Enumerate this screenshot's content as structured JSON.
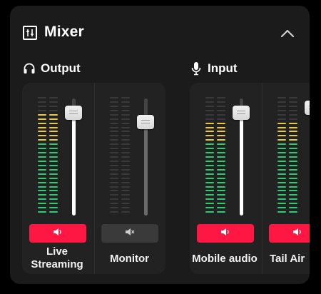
{
  "header": {
    "title": "Mixer",
    "icon": "mixer-icon",
    "collapse_icon": "chevron-up-icon"
  },
  "output": {
    "label": "Output",
    "icon": "headphones-icon",
    "channels": [
      {
        "name_line1": "Live",
        "name_line2": "Streaming",
        "muted": false,
        "level": 0.85,
        "fader": 0.88,
        "mute_color": "#ff1744"
      },
      {
        "name_line1": "Monitor",
        "name_line2": "",
        "muted": true,
        "level": 0.0,
        "fader": 0.8,
        "mute_color": "#3a3a3a"
      }
    ]
  },
  "input": {
    "label": "Input",
    "icon": "microphone-icon",
    "channels": [
      {
        "name_line1": "Mobile audio",
        "name_line2": "",
        "muted": false,
        "level": 0.78,
        "fader": 0.88,
        "mute_color": "#ff1744"
      },
      {
        "name_line1": "Tail Air",
        "name_line2": "",
        "muted": false,
        "level": 0.78,
        "fader": 0.92,
        "mute_color": "#ff1744"
      }
    ]
  },
  "colors": {
    "panel": "#1b1b1b",
    "group": "#222222",
    "meter_green": "#2ecc71",
    "meter_yellow": "#e6c84a",
    "meter_off": "#3a3a3a",
    "mute_active": "#ff1744"
  }
}
